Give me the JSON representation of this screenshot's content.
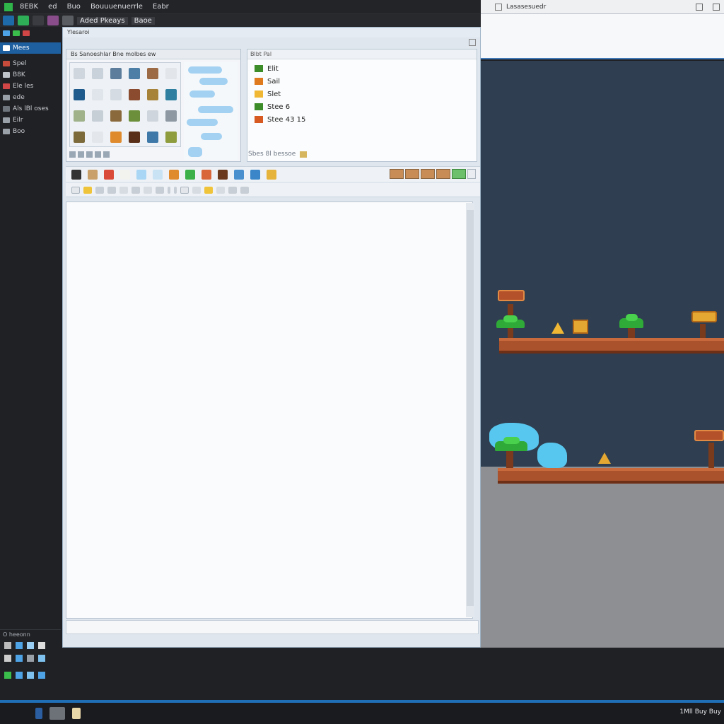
{
  "menubar": {
    "items": [
      "8EBK",
      "ed",
      "Buo",
      "Bouuuenuerrle",
      "Eabr"
    ],
    "toolbar_label": "Aded Pkeays",
    "toolbar_tag": "Baoe"
  },
  "sidebar": {
    "items": [
      "Mees",
      "Spel",
      "B8K",
      "Ele les",
      "ede",
      "Als lBl oses",
      "Eilr",
      "Boo"
    ],
    "bottom_header": "O heeonn"
  },
  "editor": {
    "title": "Ylesaroi",
    "tile_panel_header": "Bs  Sanoeshlar  Bne  molbes  ew",
    "layers_header": "Blbt Pal",
    "layers": [
      {
        "name": "Elit",
        "color": "#3c8c2a"
      },
      {
        "name": "Sail",
        "color": "#e07a1e"
      },
      {
        "name": "Slet",
        "color": "#f0b735"
      },
      {
        "name": "Stee 6",
        "color": "#3c8c2a"
      },
      {
        "name": "Stee 43 15",
        "color": "#d65a22"
      }
    ],
    "layers_footer": "Sbes 8l bessoe"
  },
  "game_window": {
    "title": "Lasasesuedr"
  },
  "taskbar": {
    "clock": "1Mll Buy Buy"
  }
}
